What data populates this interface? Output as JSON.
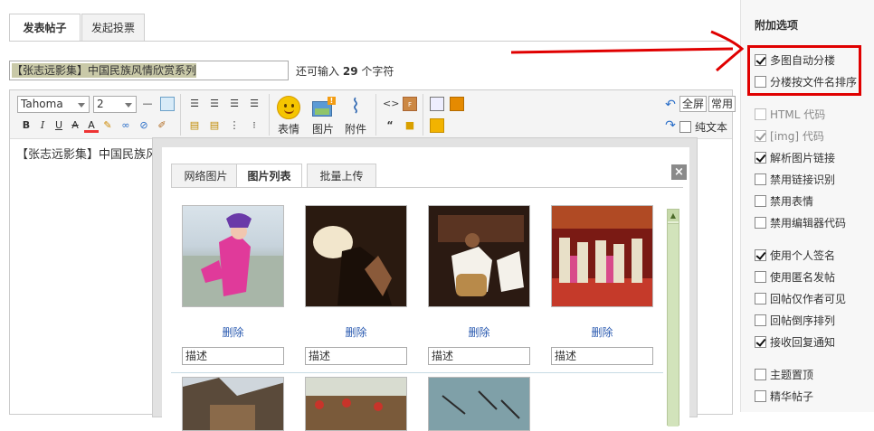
{
  "tabs": [
    "发表帖子",
    "发起投票"
  ],
  "subject": {
    "value": "【张志远影集】中国民族风情欣赏系列"
  },
  "remaining": {
    "prefix": "还可输入",
    "count": "29",
    "suffix": "个字符"
  },
  "toolbar": {
    "font": "Tahoma",
    "size": "2",
    "emoji": "表情",
    "image": "图片",
    "attach": "附件",
    "fullscreen": "全屏",
    "common": "常用",
    "plaintext": "纯文本",
    "quote_glyph": "“"
  },
  "content_text": "【张志远影集】中国民族风",
  "dialog": {
    "tabs": [
      "网络图片",
      "图片列表",
      "批量上传"
    ],
    "delete_label": "删除",
    "desc_placeholder": "描述",
    "close": "×"
  },
  "sidebar": {
    "title": "附加选项",
    "options": [
      {
        "label": "多图自动分楼",
        "checked": true,
        "disabled": false
      },
      {
        "label": "分楼按文件名排序",
        "checked": false,
        "disabled": false
      },
      {
        "label": "HTML 代码",
        "checked": false,
        "disabled": true
      },
      {
        "label": "[img] 代码",
        "checked": true,
        "disabled": true
      },
      {
        "label": "解析图片链接",
        "checked": true,
        "disabled": false
      },
      {
        "label": "禁用链接识别",
        "checked": false,
        "disabled": false
      },
      {
        "label": "禁用表情",
        "checked": false,
        "disabled": false
      },
      {
        "label": "禁用编辑器代码",
        "checked": false,
        "disabled": false
      },
      {
        "label": "使用个人签名",
        "checked": true,
        "disabled": false
      },
      {
        "label": "使用匿名发帖",
        "checked": false,
        "disabled": false
      },
      {
        "label": "回帖仅作者可见",
        "checked": false,
        "disabled": false
      },
      {
        "label": "回帖倒序排列",
        "checked": false,
        "disabled": false
      },
      {
        "label": "接收回复通知",
        "checked": true,
        "disabled": false
      },
      {
        "label": "主题置顶",
        "checked": false,
        "disabled": false
      },
      {
        "label": "精华帖子",
        "checked": false,
        "disabled": false
      }
    ]
  },
  "colors": {
    "highlight_red": "#e00000",
    "link_blue": "#2a5ab0"
  }
}
